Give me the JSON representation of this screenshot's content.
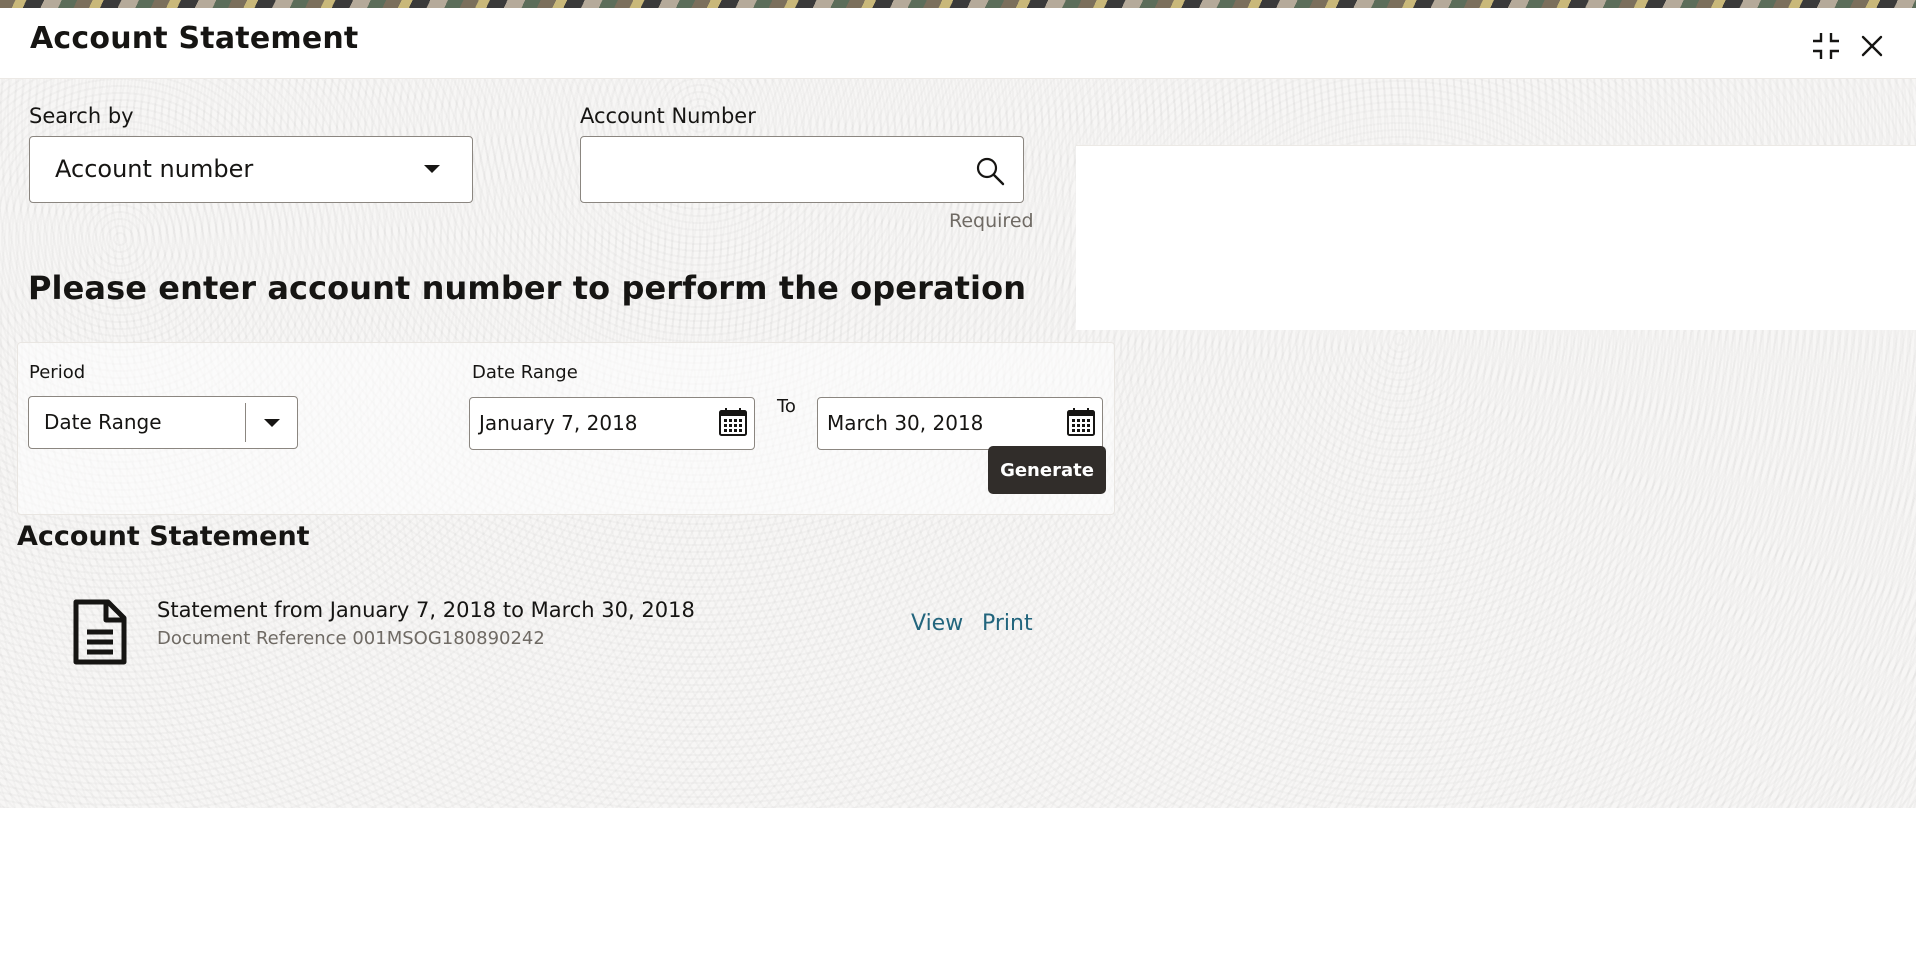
{
  "window": {
    "title": "Account Statement"
  },
  "search": {
    "search_by_label": "Search by",
    "search_by_value": "Account number",
    "account_number_label": "Account Number",
    "account_number_value": "",
    "account_number_helper": "Required"
  },
  "message": {
    "heading": "Please enter account number to perform the operation"
  },
  "filters": {
    "period_label": "Period",
    "period_value": "Date Range",
    "date_range_label": "Date Range",
    "from_date": "January 7, 2018",
    "to_label": "To",
    "to_date": "March 30, 2018",
    "generate_label": "Generate"
  },
  "statement": {
    "section_title": "Account Statement",
    "item_title": "Statement from January 7, 2018 to March 30, 2018",
    "item_reference": "Document Reference 001MSOG180890242",
    "view_label": "View",
    "print_label": "Print"
  },
  "icons": {
    "collapse": "collapse-icon",
    "close": "close-icon",
    "search": "search-icon",
    "calendar": "calendar-icon",
    "document": "document-icon",
    "dropdown": "chevron-down-icon"
  },
  "colors": {
    "primary_button": "#312d2a",
    "link": "#22657d",
    "text": "#161513"
  }
}
